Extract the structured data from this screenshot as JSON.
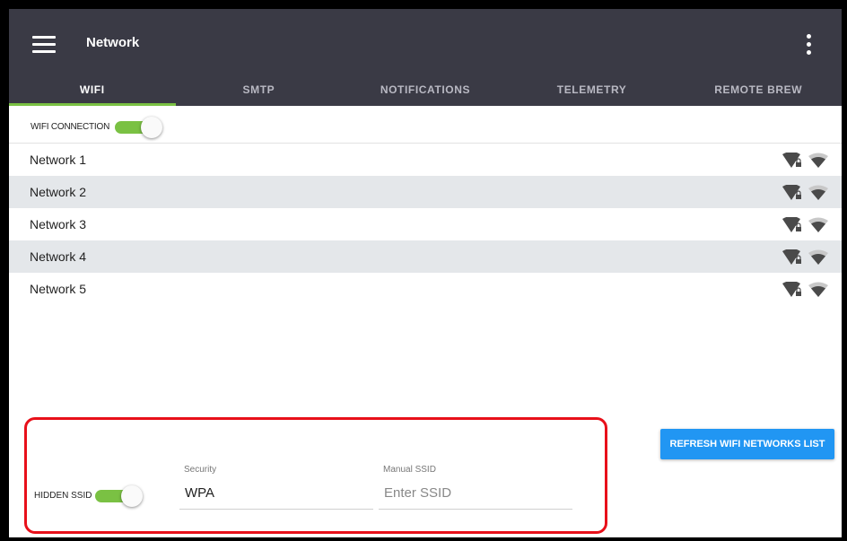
{
  "appbar": {
    "title": "Network"
  },
  "tabs": [
    {
      "label": "WIFI",
      "active": true
    },
    {
      "label": "SMTP"
    },
    {
      "label": "NOTIFICATIONS"
    },
    {
      "label": "TELEMETRY"
    },
    {
      "label": "REMOTE BREW"
    }
  ],
  "wifi_connection": {
    "label": "WIFI CONNECTION",
    "enabled": true
  },
  "networks": [
    {
      "name": "Network 1",
      "secured": true,
      "security_icon": "wifi-lock-icon",
      "signal_icon": "wifi-signal-icon"
    },
    {
      "name": "Network 2",
      "secured": true,
      "security_icon": "wifi-lock-icon",
      "signal_icon": "wifi-signal-icon"
    },
    {
      "name": "Network 3",
      "secured": true,
      "security_icon": "wifi-lock-icon",
      "signal_icon": "wifi-signal-icon"
    },
    {
      "name": "Network 4",
      "secured": true,
      "security_icon": "wifi-lock-icon",
      "signal_icon": "wifi-signal-icon"
    },
    {
      "name": "Network 5",
      "secured": true,
      "security_icon": "wifi-lock-icon",
      "signal_icon": "wifi-signal-icon"
    }
  ],
  "hidden_ssid": {
    "label": "HIDDEN SSID",
    "enabled": true,
    "security": {
      "label": "Security",
      "value": "WPA"
    },
    "manual_ssid": {
      "label": "Manual SSID",
      "placeholder": "Enter SSID",
      "value": ""
    }
  },
  "refresh_button": {
    "label": "REFRESH WIFI NETWORKS LIST"
  },
  "colors": {
    "appbar": "#3a3a45",
    "accent_green": "#7ac143",
    "button_blue": "#2196f3",
    "highlight_red": "#e8101a",
    "row_alt": "#e4e7ea"
  }
}
